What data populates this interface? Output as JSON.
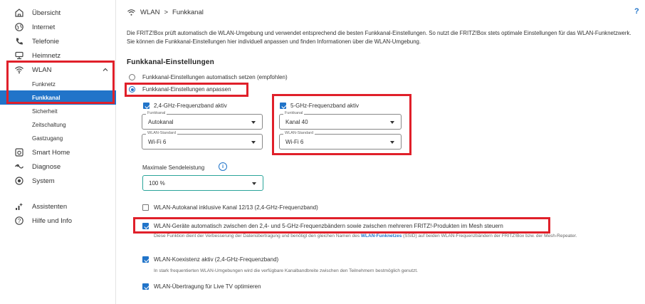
{
  "sidebar": {
    "items": [
      {
        "label": "Übersicht",
        "icon": "home-icon"
      },
      {
        "label": "Internet",
        "icon": "globe-icon"
      },
      {
        "label": "Telefonie",
        "icon": "phone-icon"
      },
      {
        "label": "Heimnetz",
        "icon": "network-icon"
      },
      {
        "label": "WLAN",
        "icon": "wifi-icon"
      },
      {
        "label": "Smart Home",
        "icon": "smart-home-icon"
      },
      {
        "label": "Diagnose",
        "icon": "diagnose-icon"
      },
      {
        "label": "System",
        "icon": "system-icon"
      },
      {
        "label": "Assistenten",
        "icon": "wizard-icon"
      },
      {
        "label": "Hilfe und Info",
        "icon": "help-icon"
      }
    ],
    "wlan_sub": [
      "Funknetz",
      "Funkkanal",
      "Sicherheit",
      "Zeitschaltung",
      "Gastzugang"
    ]
  },
  "header": {
    "breadcrumb_root": "WLAN",
    "breadcrumb_sep": ">",
    "breadcrumb_current": "Funkkanal",
    "help": "?"
  },
  "intro_text": "Die FRITZ!Box prüft automatisch die WLAN-Umgebung und verwendet entsprechend die besten Funkkanal-Einstellungen. So nutzt die FRITZ!Box stets optimale Einstellungen für das WLAN-Funknetzwerk. Sie können die Funkkanal-Einstellungen hier individuell anpassen und finden Informationen über die WLAN-Umgebung.",
  "section_title": "Funkkanal-Einstellungen",
  "radios": {
    "auto": "Funkkanal-Einstellungen automatisch setzen (empfohlen)",
    "manual": "Funkkanal-Einstellungen anpassen"
  },
  "band24": {
    "label": "2,4-GHz-Frequenzband aktiv",
    "channel_legend": "Funkkanal",
    "channel_value": "Autokanal",
    "standard_legend": "WLAN-Standard",
    "standard_value": "Wi-Fi 6"
  },
  "band5": {
    "label": "5-GHz-Frequenzband aktiv",
    "channel_legend": "Funkkanal",
    "channel_value": "Kanal 40",
    "standard_legend": "WLAN-Standard",
    "standard_value": "Wi-Fi 6"
  },
  "power": {
    "label": "Maximale Sendeleistung",
    "info": "i",
    "value": "100 %"
  },
  "options": {
    "autochannel": "WLAN-Autokanal inklusive Kanal 12/13 (2,4-GHz-Frequenzband)",
    "steering": "WLAN-Geräte automatisch zwischen den 2,4- und 5-GHz-Frequenzbändern sowie zwischen mehreren FRITZ!-Produkten im Mesh steuern",
    "steering_desc_1": "Diese Funktion dient der Verbesserung der Datenübertragung und benötigt den gleichen Namen des ",
    "steering_desc_link": "WLAN-Funknetzes",
    "steering_desc_ssid": " (SSID)",
    "steering_desc_2": " auf beiden WLAN-Frequenzbändern der FRITZ!Box bzw. der Mesh-Repeater.",
    "coexist": "WLAN-Koexistenz aktiv (2,4-GHz-Frequenzband)",
    "coexist_desc": "In stark frequentierten WLAN-Umgebungen wird die verfügbare Kanalbandbreite zwischen den Teilnehmern bestmöglich genutzt.",
    "livetv": "WLAN-Übertragung für Live TV optimieren"
  },
  "colors": {
    "accent": "#2174c9",
    "highlight": "#e0202a",
    "teal": "#2aa59a"
  }
}
